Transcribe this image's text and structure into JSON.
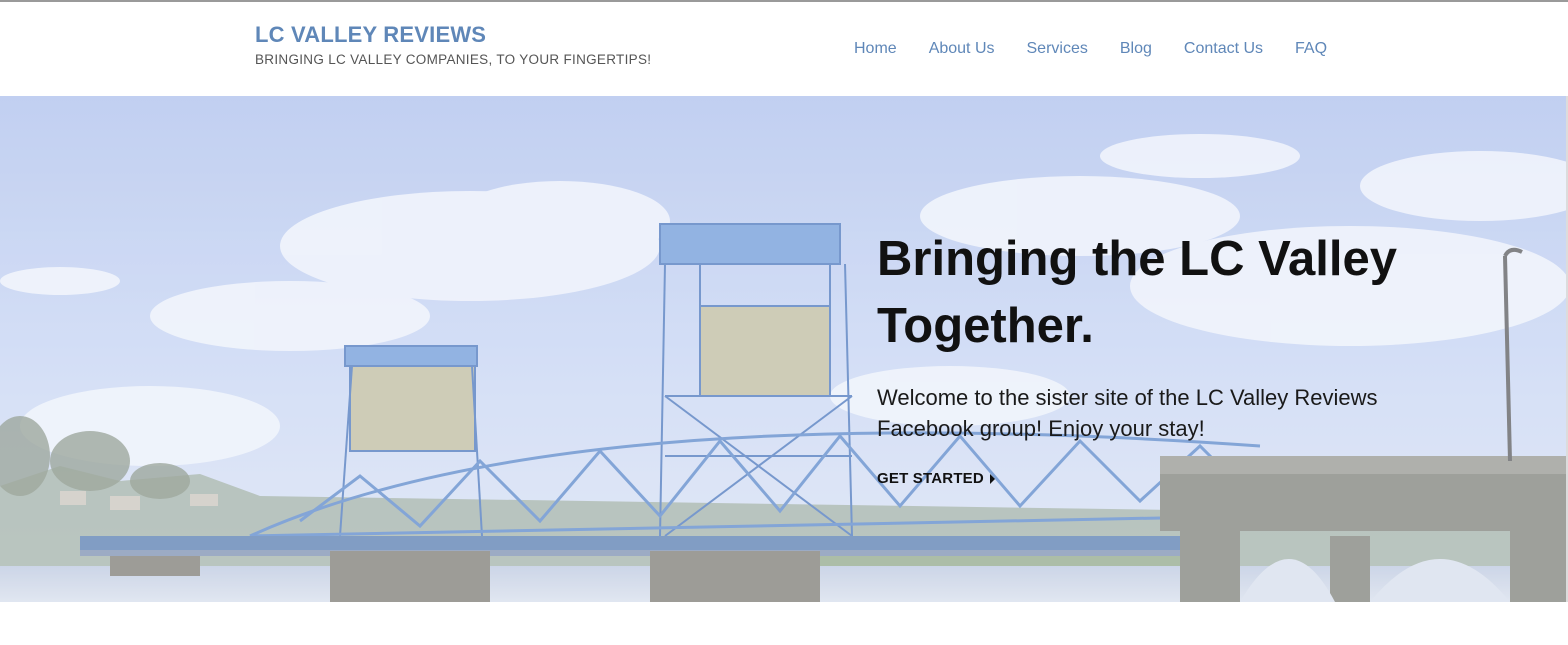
{
  "header": {
    "site_title": "LC VALLEY REVIEWS",
    "tagline": "BRINGING LC VALLEY COMPANIES, TO YOUR FINGERTIPS!"
  },
  "nav": {
    "items": [
      "Home",
      "About Us",
      "Services",
      "Blog",
      "Contact Us",
      "FAQ"
    ]
  },
  "hero": {
    "title": "Bringing the LC Valley Together.",
    "text": "Welcome to the sister site of the LC Valley Reviews Facebook group! Enjoy your stay!",
    "cta_label": "GET STARTED",
    "cta_icon": "caret-right-icon",
    "background": "bridge-photo"
  },
  "colors": {
    "brand": "#5f87b8",
    "text_dark": "#111111",
    "sky": "#c9d6f2",
    "bridge": "#7fa3d4"
  }
}
